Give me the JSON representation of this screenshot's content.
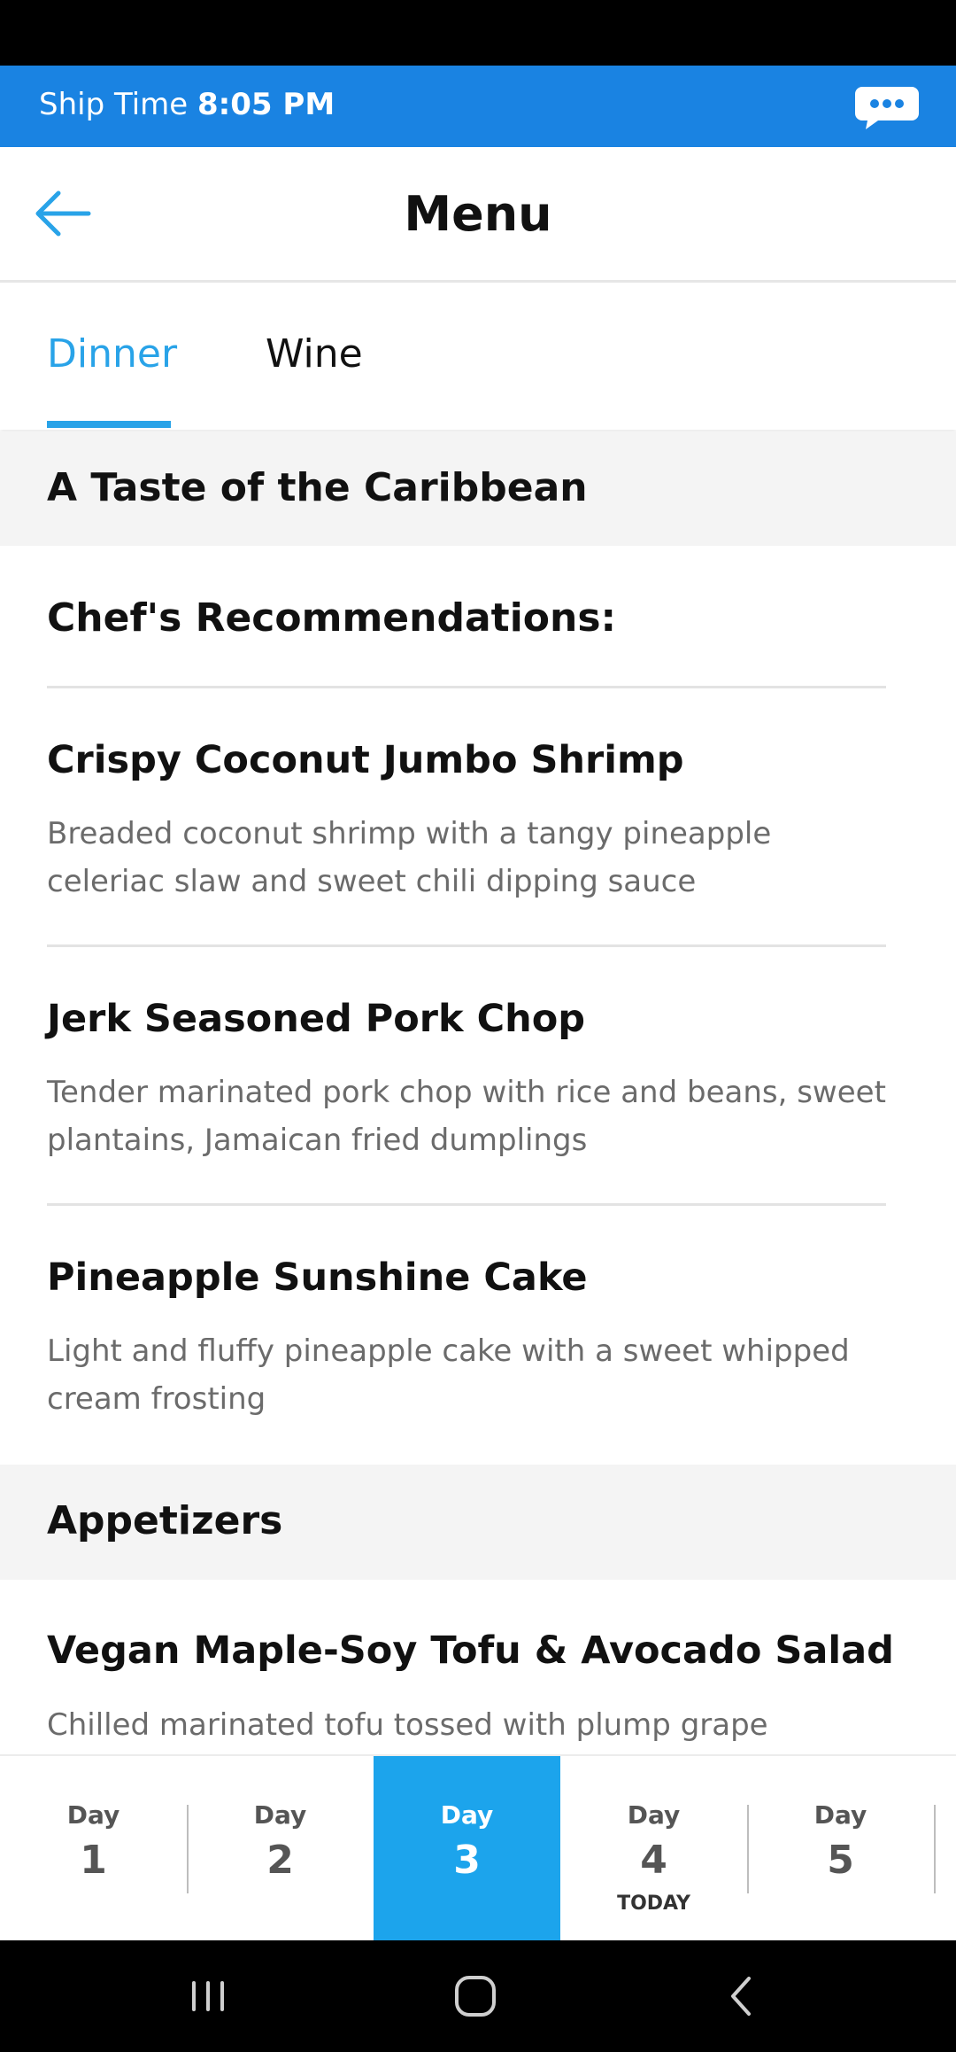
{
  "ship_time": {
    "label": "Ship Time",
    "value": "8:05 PM"
  },
  "header": {
    "title": "Menu",
    "back_icon": "arrow-left-icon",
    "chat_icon": "chat-bubble-icon"
  },
  "tabs": [
    {
      "label": "Dinner",
      "active": true
    },
    {
      "label": "Wine",
      "active": false
    }
  ],
  "sections": {
    "taste": "A Taste of the Caribbean",
    "recommendations": "Chef's Recommendations:",
    "appetizers": "Appetizers"
  },
  "items": [
    {
      "title": "Crispy Coconut Jumbo Shrimp",
      "description": "Breaded coconut shrimp with a tangy pineapple celeriac slaw and sweet chili dipping sauce"
    },
    {
      "title": "Jerk Seasoned Pork Chop",
      "description": "Tender marinated pork chop with rice and beans, sweet plantains, Jamaican fried dumplings"
    },
    {
      "title": "Pineapple Sunshine Cake",
      "description": "Light and fluffy pineapple cake with a sweet whipped cream frosting"
    },
    {
      "title": "Vegan Maple-Soy Tofu & Avocado Salad",
      "description": "Chilled marinated tofu tossed with plump grape"
    }
  ],
  "days": [
    {
      "label": "Day",
      "number": "1",
      "note": ""
    },
    {
      "label": "Day",
      "number": "2",
      "note": ""
    },
    {
      "label": "Day",
      "number": "3",
      "note": "",
      "active": true
    },
    {
      "label": "Day",
      "number": "4",
      "note": "TODAY"
    },
    {
      "label": "Day",
      "number": "5",
      "note": ""
    }
  ],
  "colors": {
    "accent": "#1a83e2",
    "tab_active": "#29a3e8",
    "day_active": "#1ca4ec"
  }
}
